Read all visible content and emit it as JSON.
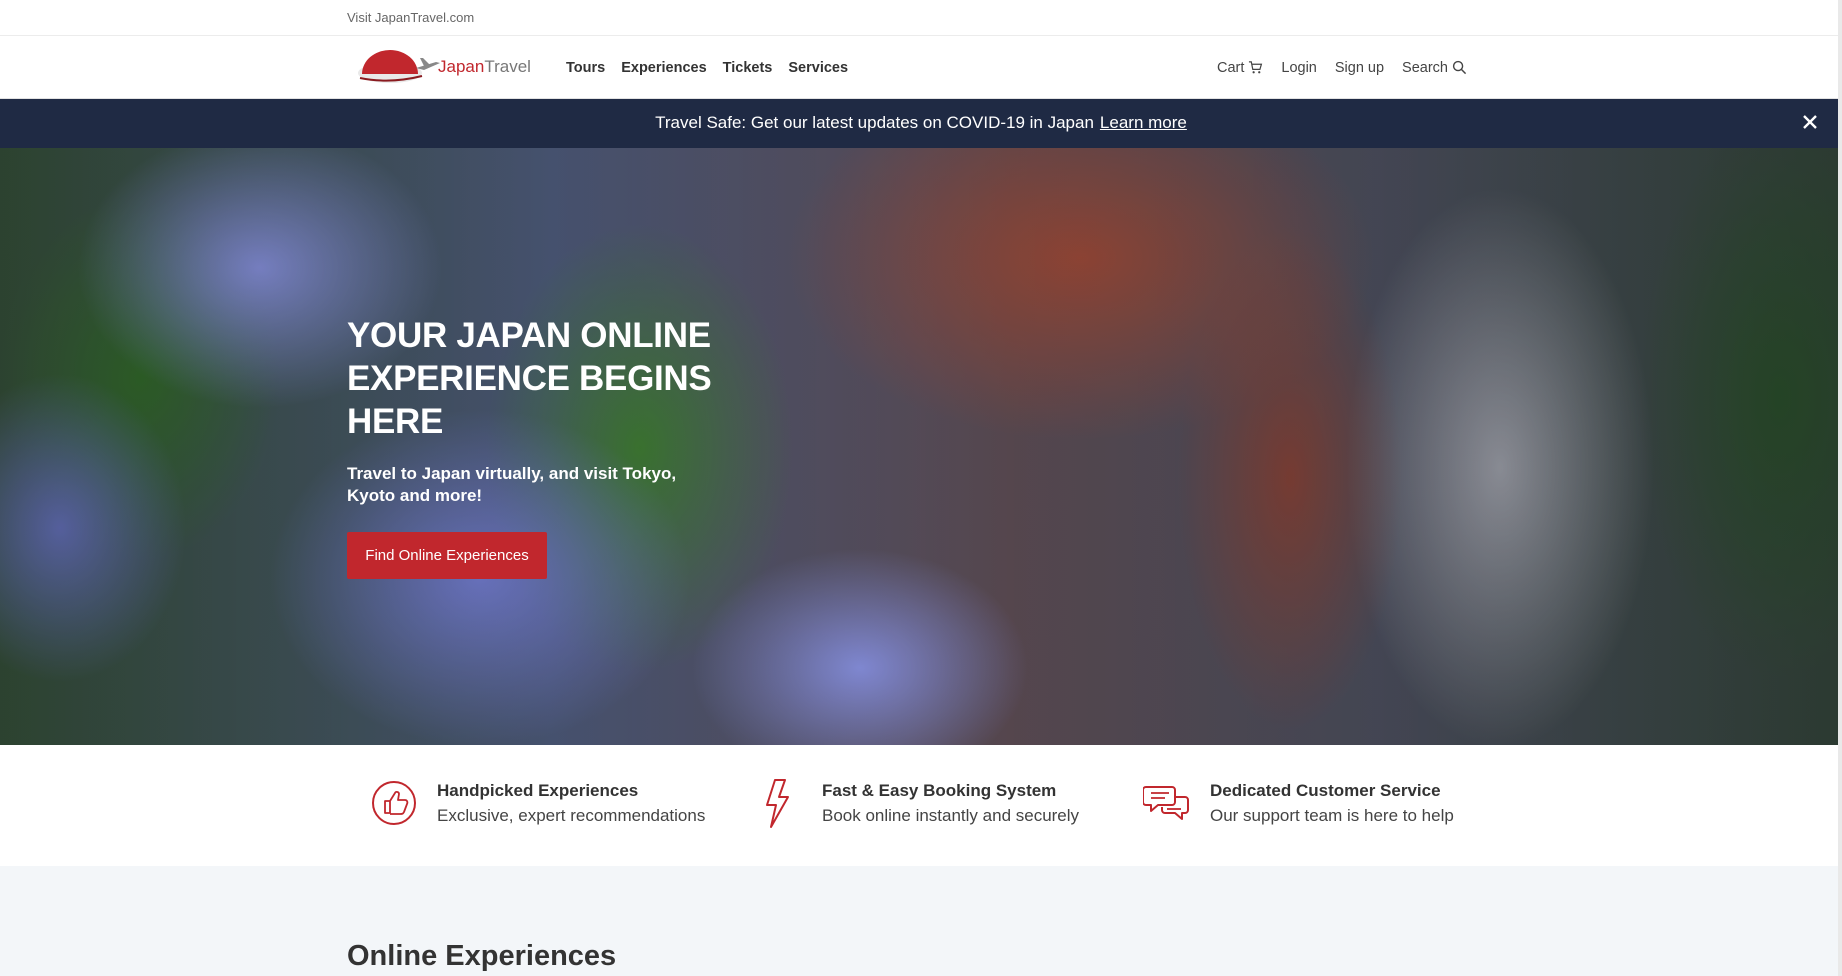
{
  "topbar": {
    "visit_link": "Visit JapanTravel.com"
  },
  "logo": {
    "brand_part1": "Japan",
    "brand_part2": "Travel"
  },
  "nav": {
    "left": [
      "Tours",
      "Experiences",
      "Tickets",
      "Services"
    ],
    "cart": "Cart",
    "login": "Login",
    "signup": "Sign up",
    "search": "Search"
  },
  "notice": {
    "message": "Travel Safe: Get our latest updates on COVID-19 in Japan",
    "link": "Learn more"
  },
  "hero": {
    "title": "YOUR JAPAN ONLINE EXPERIENCE BEGINS HERE",
    "subtitle": "Travel to Japan virtually, and visit Tokyo, Kyoto and more!",
    "cta": "Find Online Experiences"
  },
  "features": [
    {
      "icon": "thumbs-up-icon",
      "title": "Handpicked Experiences",
      "desc": "Exclusive, expert recommendations"
    },
    {
      "icon": "lightning-icon",
      "title": "Fast & Easy Booking System",
      "desc": "Book online instantly and securely"
    },
    {
      "icon": "chat-bubbles-icon",
      "title": "Dedicated Customer Service",
      "desc": "Our support team is here to help"
    }
  ],
  "section": {
    "heading": "Online Experiences"
  },
  "colors": {
    "accent": "#c1272d",
    "banner_bg": "#1f2a44",
    "section_bg": "#f3f6f9"
  }
}
